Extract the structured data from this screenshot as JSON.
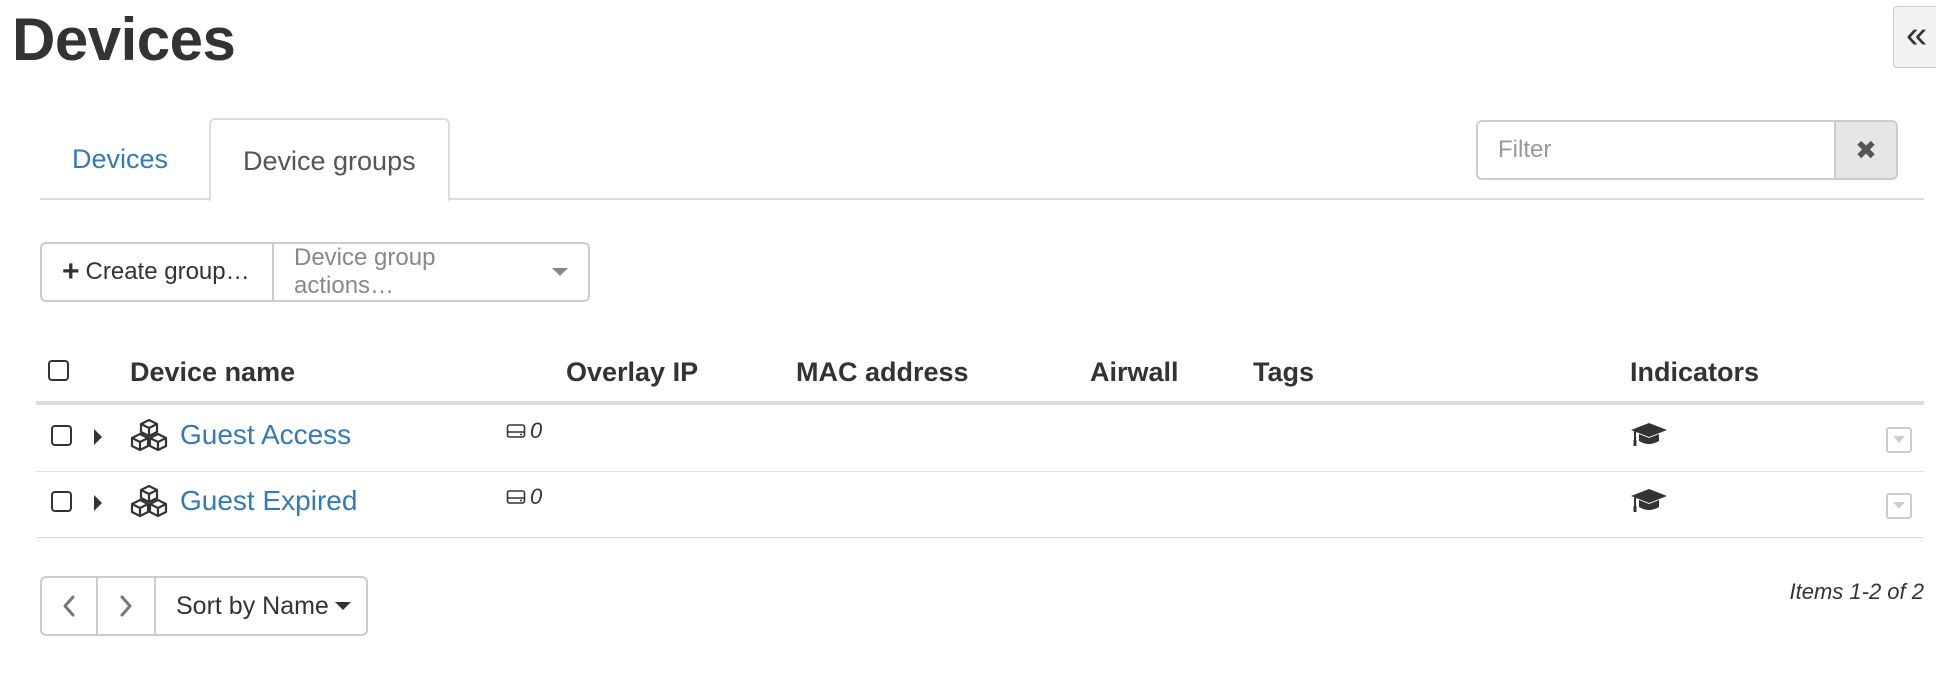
{
  "page": {
    "title": "Devices"
  },
  "collapse": {
    "icon": "double-chevron-left-icon",
    "glyph": "«"
  },
  "tabs": [
    {
      "label": "Devices",
      "active": false
    },
    {
      "label": "Device groups",
      "active": true
    }
  ],
  "filter": {
    "placeholder": "Filter",
    "value": "",
    "clear_icon": "close-icon",
    "clear_glyph": "✖"
  },
  "toolbar": {
    "create_label": "Create group…",
    "create_icon": "plus-icon",
    "create_glyph": "+",
    "actions_label": "Device group actions…"
  },
  "table": {
    "columns": [
      "Device name",
      "Overlay IP",
      "MAC address",
      "Airwall",
      "Tags",
      "Indicators"
    ],
    "rows": [
      {
        "name": "Guest Access",
        "device_count": "0",
        "icon": "device-group-icon",
        "indicator_icon": "graduation-cap-icon"
      },
      {
        "name": "Guest Expired",
        "device_count": "0",
        "icon": "device-group-icon",
        "indicator_icon": "graduation-cap-icon"
      }
    ]
  },
  "pagination": {
    "sort_label": "Sort by Name",
    "items_text": "Items 1-2 of 2"
  },
  "colors": {
    "link": "#337ab7",
    "border": "#cccccc",
    "text": "#333333",
    "muted": "#888888"
  }
}
